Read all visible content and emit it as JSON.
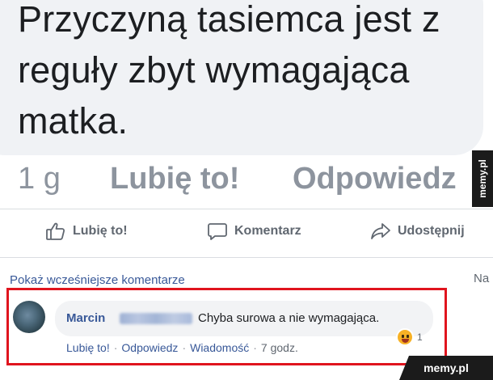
{
  "post": {
    "text_line1": "Przyczyną tasiemca jest z",
    "text_line2": "reguły zbyt wymagająca",
    "text_line3": "matka.",
    "time": "1 g",
    "like_label": "Lubię to!",
    "reply_label": "Odpowiedz"
  },
  "actions": {
    "like": "Lubię to!",
    "comment": "Komentarz",
    "share": "Udostępnij"
  },
  "comments": {
    "show_previous": "Pokaż wcześniejsze komentarze",
    "right_cutoff": "Na",
    "comment": {
      "author": "Marcin",
      "text": "Chyba surowa a nie wymagająca.",
      "reaction_count": "1",
      "like_label": "Lubię to!",
      "reply_label": "Odpowiedz",
      "message_label": "Wiadomość",
      "time": "7 godz.",
      "separator": "·"
    }
  },
  "watermarks": {
    "side": "memy.pl",
    "corner": "memy.pl"
  },
  "colors": {
    "link": "#385898",
    "highlight_border": "#e0141e",
    "bubble_bg": "#f0f2f5"
  },
  "icons": [
    "thumbs-up-icon",
    "comment-icon",
    "share-icon",
    "laughing-emoji-icon"
  ]
}
